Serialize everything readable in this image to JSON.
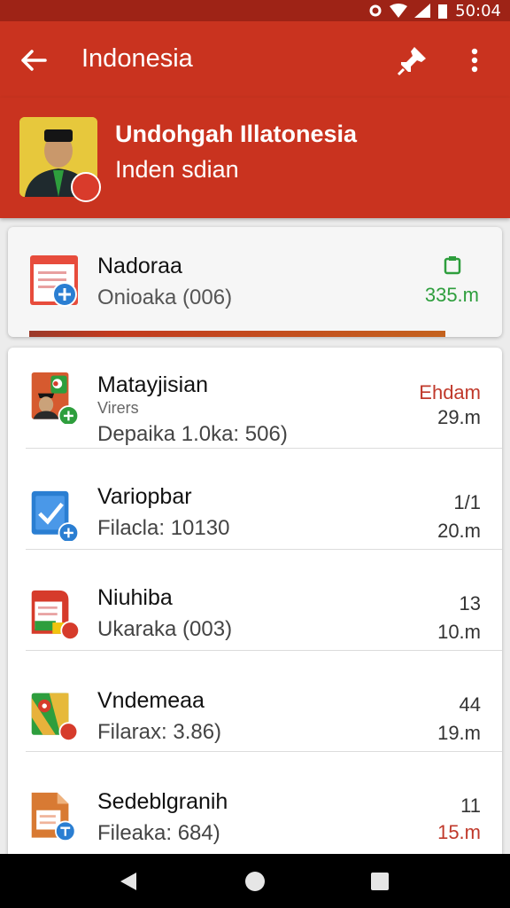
{
  "status": {
    "time": "50:04"
  },
  "appbar": {
    "title": "Indonesia"
  },
  "header": {
    "name": "Undohgah Illatonesia",
    "subtitle": "Inden sdian"
  },
  "featured": {
    "title": "Nadoraa",
    "subtitle": "Onioaka (006)",
    "meta": "335.m",
    "progress_percent": 100
  },
  "items": [
    {
      "title": "Matayjisian",
      "tag": "Virers",
      "subtitle": "Depaika 1.0ka: 506)",
      "right_top": "Ehdam",
      "right_bottom": "29.m",
      "right_top_color": "#c0392b"
    },
    {
      "title": "Variopbar",
      "subtitle": "Filacla: 10130",
      "right_top": "1/1",
      "right_bottom": "20.m"
    },
    {
      "title": "Niuhiba",
      "subtitle": "Ukaraka (003)",
      "right_top": "13",
      "right_bottom": "10.m"
    },
    {
      "title": "Vndemeaa",
      "subtitle": "Filarax: 3.86)",
      "right_top": "44",
      "right_bottom": "19.m"
    },
    {
      "title": "Sedeblgranih",
      "subtitle": "Fileaka: 684)",
      "right_top": "11",
      "right_bottom": "15.m",
      "right_bottom_color": "#c0392b"
    }
  ],
  "icons": {
    "back": "arrow-left-icon",
    "pin": "pin-icon",
    "more": "more-vert-icon",
    "nav": [
      "back-triangle-icon",
      "home-circle-icon",
      "recents-square-icon"
    ]
  }
}
